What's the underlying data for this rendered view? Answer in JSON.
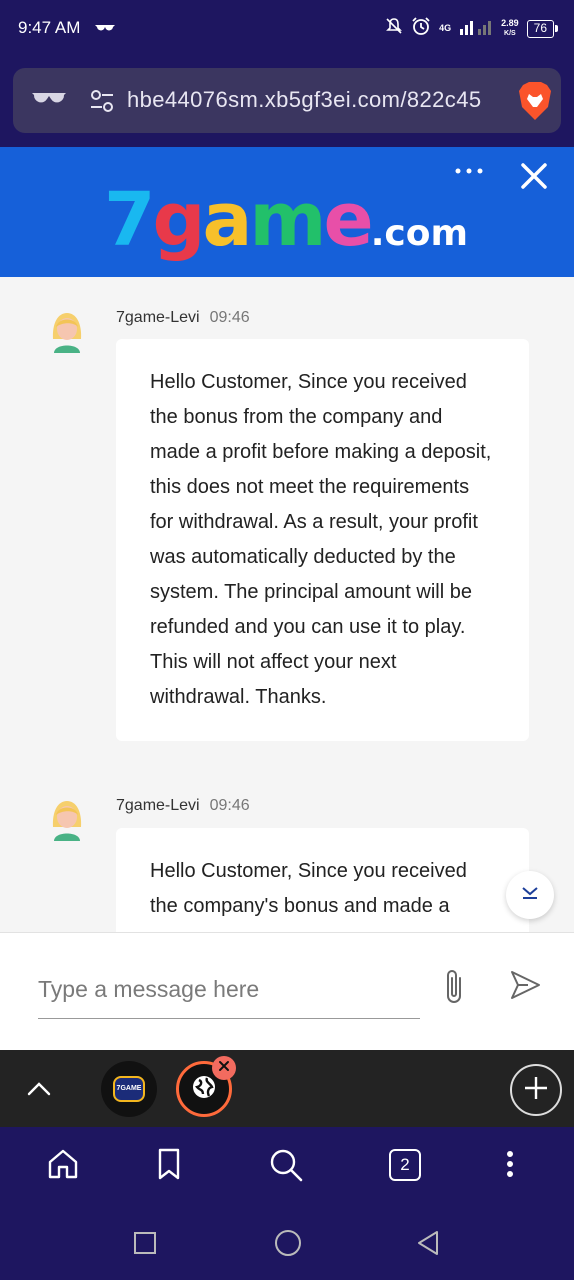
{
  "status_bar": {
    "time": "9:47 AM",
    "network": "4G",
    "speed_value": "2.89",
    "speed_unit": "K/S",
    "battery": "76"
  },
  "browser": {
    "url": "hbe44076sm.xb5gf3ei.com/822c45",
    "tab_count": "2"
  },
  "site": {
    "logo_digit": "7",
    "logo_g": "g",
    "logo_a": "a",
    "logo_m": "m",
    "logo_e": "e",
    "logo_domain": ".com"
  },
  "messages": [
    {
      "sender": "7game-Levi",
      "time": "09:46",
      "text": "Hello Customer, Since you received the bonus from the company and made a profit before making a deposit, this does not meet the requirements for withdrawal. As a result, your profit was automatically deducted by the system. The principal amount will be refunded and you can use it to play. This will not affect your next withdrawal. Thanks."
    },
    {
      "sender": "7game-Levi",
      "time": "09:46",
      "text": "Hello Customer, Since you received the company's bonus and made a"
    }
  ],
  "input": {
    "placeholder": "Type a message here"
  },
  "tabs": {
    "tab1_favicon_text": "7GAME"
  },
  "colors": {
    "browser_bg": "#1e1660",
    "header_blue": "#1660d9",
    "accent_orange": "#ff6a3b"
  }
}
